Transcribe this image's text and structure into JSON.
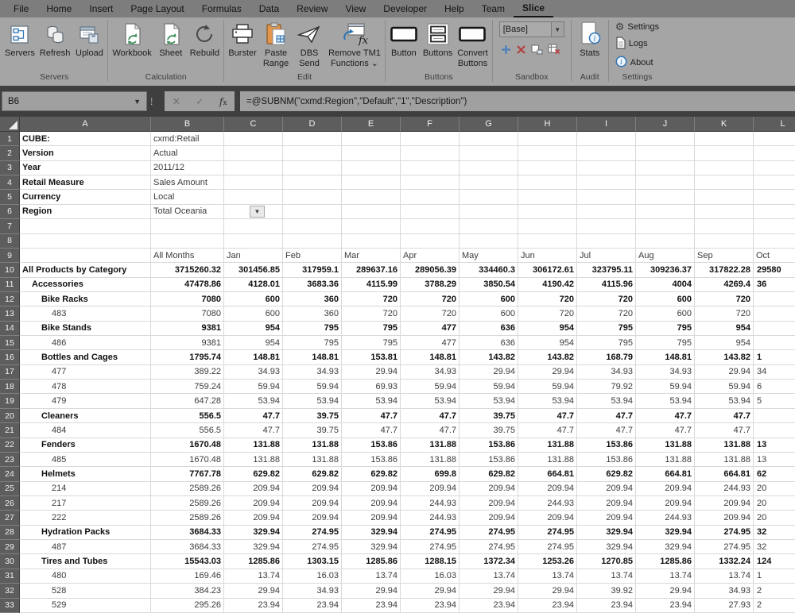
{
  "ribbon": {
    "tabs": [
      "File",
      "Home",
      "Insert",
      "Page Layout",
      "Formulas",
      "Data",
      "Review",
      "View",
      "Developer",
      "Help",
      "Team",
      "Slice"
    ],
    "active_tab": "Slice",
    "groups": [
      {
        "name": "Servers",
        "buttons": [
          {
            "lines": [
              "Servers"
            ],
            "icon": "servers-icon"
          },
          {
            "lines": [
              "Refresh"
            ],
            "icon": "refresh-icon"
          },
          {
            "lines": [
              "Upload"
            ],
            "icon": "upload-icon"
          }
        ]
      },
      {
        "name": "Calculation",
        "buttons": [
          {
            "lines": [
              "Workbook"
            ],
            "icon": "workbook-icon"
          },
          {
            "lines": [
              "Sheet"
            ],
            "icon": "sheet-icon"
          },
          {
            "lines": [
              "Rebuild"
            ],
            "icon": "rebuild-icon"
          }
        ]
      },
      {
        "name": "Edit",
        "buttons": [
          {
            "lines": [
              "Burster"
            ],
            "icon": "burster-icon"
          },
          {
            "lines": [
              "Paste",
              "Range"
            ],
            "icon": "paste-range-icon"
          },
          {
            "lines": [
              "DBS",
              "Send"
            ],
            "icon": "dbs-send-icon"
          },
          {
            "lines": [
              "Remove TM1",
              "Functions ⌄"
            ],
            "icon": "remove-tm1-icon"
          }
        ]
      },
      {
        "name": "Buttons",
        "buttons": [
          {
            "lines": [
              "Button"
            ],
            "icon": "button-icon"
          },
          {
            "lines": [
              "Buttons"
            ],
            "icon": "buttons-icon"
          },
          {
            "lines": [
              "Convert",
              "Buttons"
            ],
            "icon": "convert-buttons-icon"
          }
        ]
      },
      {
        "name": "Sandbox",
        "combo_value": "[Base]",
        "icons": [
          "add-sandbox-icon",
          "delete-sandbox-icon",
          "commit-sandbox-icon",
          "discard-sandbox-icon"
        ]
      },
      {
        "name": "Audit",
        "buttons": [
          {
            "lines": [
              "Stats"
            ],
            "icon": "stats-icon"
          }
        ]
      },
      {
        "name": "Settings",
        "items": [
          {
            "label": "Settings",
            "icon": "gear-icon"
          },
          {
            "label": "Logs",
            "icon": "logs-icon"
          },
          {
            "label": "About",
            "icon": "about-icon"
          }
        ]
      }
    ]
  },
  "formula_bar": {
    "name_box": "B6",
    "formula": "=@SUBNM(\"cxmd:Region\",\"Default\",\"1\",\"Description\")"
  },
  "colors": {
    "icon_blue": "#2e75b6",
    "paste_orange": "#d9853b",
    "add_blue": "#4a7ebb",
    "delete_red": "#b34040",
    "calc_green": "#3e8e5a",
    "header_gray": "#5d5d5d"
  },
  "sheet": {
    "columns": [
      "A",
      "B",
      "C",
      "D",
      "E",
      "F",
      "G",
      "H",
      "I",
      "J",
      "K",
      "L"
    ],
    "info_rows": [
      {
        "row": 1,
        "label": "CUBE:",
        "value": "cxmd:Retail"
      },
      {
        "row": 2,
        "label": "Version",
        "value": "Actual"
      },
      {
        "row": 3,
        "label": "Year",
        "value": "2011/12"
      },
      {
        "row": 4,
        "label": "Retail Measure",
        "value": "Sales Amount"
      },
      {
        "row": 5,
        "label": "Currency",
        "value": "Local"
      },
      {
        "row": 6,
        "label": "Region",
        "value": "Total Oceania",
        "has_dropdown": true
      }
    ],
    "header_row": {
      "row": 9,
      "labels": [
        "All Months",
        "Jan",
        "Feb",
        "Mar",
        "Apr",
        "May",
        "Jun",
        "Jul",
        "Aug",
        "Sep",
        "Oct"
      ]
    },
    "data_rows": [
      {
        "row": 10,
        "label": "All Products by Category",
        "indent": 0,
        "bold": true,
        "values": [
          "3715260.32",
          "301456.85",
          "317959.1",
          "289637.16",
          "289056.39",
          "334460.3",
          "306172.61",
          "323795.11",
          "309236.37",
          "317822.28"
        ],
        "oct_partial": "29580"
      },
      {
        "row": 11,
        "label": "Accessories",
        "indent": 1,
        "bold": true,
        "values": [
          "47478.86",
          "4128.01",
          "3683.36",
          "4115.99",
          "3788.29",
          "3850.54",
          "4190.42",
          "4115.96",
          "4004",
          "4269.4"
        ],
        "oct_partial": "36"
      },
      {
        "row": 12,
        "label": "Bike Racks",
        "indent": 2,
        "bold": true,
        "values": [
          "7080",
          "600",
          "360",
          "720",
          "720",
          "600",
          "720",
          "720",
          "600",
          "720"
        ],
        "oct_partial": ""
      },
      {
        "row": 13,
        "label": "483",
        "indent": 3,
        "bold": false,
        "values": [
          "7080",
          "600",
          "360",
          "720",
          "720",
          "600",
          "720",
          "720",
          "600",
          "720"
        ],
        "oct_partial": ""
      },
      {
        "row": 14,
        "label": "Bike Stands",
        "indent": 2,
        "bold": true,
        "values": [
          "9381",
          "954",
          "795",
          "795",
          "477",
          "636",
          "954",
          "795",
          "795",
          "954"
        ],
        "oct_partial": ""
      },
      {
        "row": 15,
        "label": "486",
        "indent": 3,
        "bold": false,
        "values": [
          "9381",
          "954",
          "795",
          "795",
          "477",
          "636",
          "954",
          "795",
          "795",
          "954"
        ],
        "oct_partial": ""
      },
      {
        "row": 16,
        "label": "Bottles and Cages",
        "indent": 2,
        "bold": true,
        "values": [
          "1795.74",
          "148.81",
          "148.81",
          "153.81",
          "148.81",
          "143.82",
          "143.82",
          "168.79",
          "148.81",
          "143.82"
        ],
        "oct_partial": "1"
      },
      {
        "row": 17,
        "label": "477",
        "indent": 3,
        "bold": false,
        "values": [
          "389.22",
          "34.93",
          "34.93",
          "29.94",
          "34.93",
          "29.94",
          "29.94",
          "34.93",
          "34.93",
          "29.94"
        ],
        "oct_partial": "34"
      },
      {
        "row": 18,
        "label": "478",
        "indent": 3,
        "bold": false,
        "values": [
          "759.24",
          "59.94",
          "59.94",
          "69.93",
          "59.94",
          "59.94",
          "59.94",
          "79.92",
          "59.94",
          "59.94"
        ],
        "oct_partial": "6"
      },
      {
        "row": 19,
        "label": "479",
        "indent": 3,
        "bold": false,
        "values": [
          "647.28",
          "53.94",
          "53.94",
          "53.94",
          "53.94",
          "53.94",
          "53.94",
          "53.94",
          "53.94",
          "53.94"
        ],
        "oct_partial": "5"
      },
      {
        "row": 20,
        "label": "Cleaners",
        "indent": 2,
        "bold": true,
        "values": [
          "556.5",
          "47.7",
          "39.75",
          "47.7",
          "47.7",
          "39.75",
          "47.7",
          "47.7",
          "47.7",
          "47.7"
        ],
        "oct_partial": ""
      },
      {
        "row": 21,
        "label": "484",
        "indent": 3,
        "bold": false,
        "values": [
          "556.5",
          "47.7",
          "39.75",
          "47.7",
          "47.7",
          "39.75",
          "47.7",
          "47.7",
          "47.7",
          "47.7"
        ],
        "oct_partial": ""
      },
      {
        "row": 22,
        "label": "Fenders",
        "indent": 2,
        "bold": true,
        "values": [
          "1670.48",
          "131.88",
          "131.88",
          "153.86",
          "131.88",
          "153.86",
          "131.88",
          "153.86",
          "131.88",
          "131.88"
        ],
        "oct_partial": "13"
      },
      {
        "row": 23,
        "label": "485",
        "indent": 3,
        "bold": false,
        "values": [
          "1670.48",
          "131.88",
          "131.88",
          "153.86",
          "131.88",
          "153.86",
          "131.88",
          "153.86",
          "131.88",
          "131.88"
        ],
        "oct_partial": "13"
      },
      {
        "row": 24,
        "label": "Helmets",
        "indent": 2,
        "bold": true,
        "values": [
          "7767.78",
          "629.82",
          "629.82",
          "629.82",
          "699.8",
          "629.82",
          "664.81",
          "629.82",
          "664.81",
          "664.81"
        ],
        "oct_partial": "62"
      },
      {
        "row": 25,
        "label": "214",
        "indent": 3,
        "bold": false,
        "values": [
          "2589.26",
          "209.94",
          "209.94",
          "209.94",
          "209.94",
          "209.94",
          "209.94",
          "209.94",
          "209.94",
          "244.93"
        ],
        "oct_partial": "20"
      },
      {
        "row": 26,
        "label": "217",
        "indent": 3,
        "bold": false,
        "values": [
          "2589.26",
          "209.94",
          "209.94",
          "209.94",
          "244.93",
          "209.94",
          "244.93",
          "209.94",
          "209.94",
          "209.94"
        ],
        "oct_partial": "20"
      },
      {
        "row": 27,
        "label": "222",
        "indent": 3,
        "bold": false,
        "values": [
          "2589.26",
          "209.94",
          "209.94",
          "209.94",
          "244.93",
          "209.94",
          "209.94",
          "209.94",
          "244.93",
          "209.94"
        ],
        "oct_partial": "20"
      },
      {
        "row": 28,
        "label": "Hydration Packs",
        "indent": 2,
        "bold": true,
        "values": [
          "3684.33",
          "329.94",
          "274.95",
          "329.94",
          "274.95",
          "274.95",
          "274.95",
          "329.94",
          "329.94",
          "274.95"
        ],
        "oct_partial": "32"
      },
      {
        "row": 29,
        "label": "487",
        "indent": 3,
        "bold": false,
        "values": [
          "3684.33",
          "329.94",
          "274.95",
          "329.94",
          "274.95",
          "274.95",
          "274.95",
          "329.94",
          "329.94",
          "274.95"
        ],
        "oct_partial": "32"
      },
      {
        "row": 30,
        "label": "Tires and Tubes",
        "indent": 2,
        "bold": true,
        "values": [
          "15543.03",
          "1285.86",
          "1303.15",
          "1285.86",
          "1288.15",
          "1372.34",
          "1253.26",
          "1270.85",
          "1285.86",
          "1332.24"
        ],
        "oct_partial": "124"
      },
      {
        "row": 31,
        "label": "480",
        "indent": 3,
        "bold": false,
        "values": [
          "169.46",
          "13.74",
          "16.03",
          "13.74",
          "16.03",
          "13.74",
          "13.74",
          "13.74",
          "13.74",
          "13.74"
        ],
        "oct_partial": "1"
      },
      {
        "row": 32,
        "label": "528",
        "indent": 3,
        "bold": false,
        "values": [
          "384.23",
          "29.94",
          "34.93",
          "29.94",
          "29.94",
          "29.94",
          "29.94",
          "39.92",
          "29.94",
          "34.93"
        ],
        "oct_partial": "2"
      },
      {
        "row": 33,
        "label": "529",
        "indent": 3,
        "bold": false,
        "values": [
          "295.26",
          "23.94",
          "23.94",
          "23.94",
          "23.94",
          "23.94",
          "23.94",
          "23.94",
          "23.94",
          "27.93"
        ],
        "oct_partial": "2"
      }
    ]
  }
}
